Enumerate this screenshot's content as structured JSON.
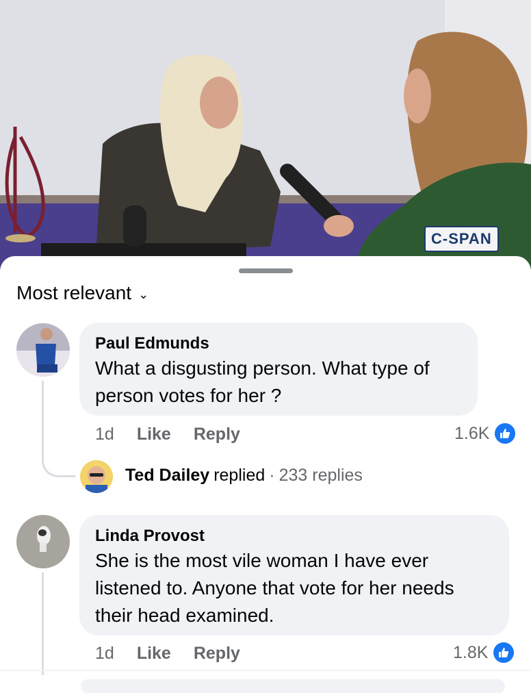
{
  "video": {
    "watermark": "C-SPAN"
  },
  "sort": {
    "label": "Most relevant"
  },
  "comments": [
    {
      "author": "Paul Edmunds",
      "text_lines": [
        "What a disgusting person. What type of",
        "person votes for her ?"
      ],
      "time": "1d",
      "like_label": "Like",
      "reply_label": "Reply",
      "reaction_count": "1.6K"
    },
    {
      "author": "Linda Provost",
      "text_lines": [
        "She is the most vile woman I have ever",
        "listened to.  Anyone that vote for her needs",
        "their head examined."
      ],
      "time": "1d",
      "like_label": "Like",
      "reply_label": "Reply",
      "reaction_count": "1.8K"
    }
  ],
  "reply_summary": {
    "name": "Ted Dailey",
    "action": "replied",
    "separator": "·",
    "count": "233 replies"
  },
  "colors": {
    "accent": "#1877f2",
    "bubble": "#f0f2f5",
    "muted": "#65676b"
  },
  "icons": {
    "reaction": "thumbs-up-icon",
    "sort": "chevron-down-icon"
  }
}
